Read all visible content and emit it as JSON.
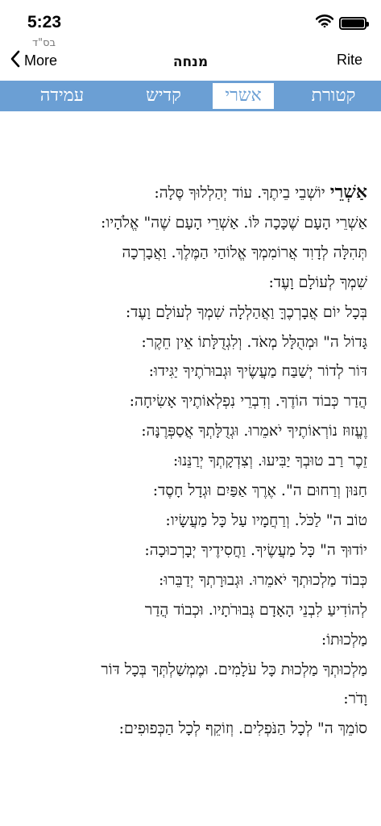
{
  "status_bar": {
    "time": "5:23",
    "icons": [
      "wifi-icon",
      "battery-icon"
    ]
  },
  "header": {
    "hebrew_date": "בס\"ד",
    "back_label": "More",
    "title": "מנחה",
    "rite_label": "Rite"
  },
  "tabs": [
    {
      "label": "קטורת",
      "active": false
    },
    {
      "label": "אשרי",
      "active": true
    },
    {
      "label": "קדיש",
      "active": false
    },
    {
      "label": "עמידה",
      "active": false
    }
  ],
  "colors": {
    "tab_bar": "#6b9fd4",
    "active_tab_background": "#ffffff",
    "tab_text": "#ffffff"
  },
  "prayer": {
    "first_word": "אַשְׁרֵי",
    "first_line_rest": " יוֹשְׁבֵי בֵיתֶךָ. עוֹד יְהַלְלוּךָ סֶּלָה:",
    "lines": [
      "אַשְׁרֵי הָעָם שֶׁכָּכָה לּוֹ. אַשְׁרֵי הָעָם שֶׁה\" אֱלֹהָיו:",
      "תְּהִלָּה לְדָוִד אֲרוֹמִמְךָ אֱלוֹהַי הַמֶּלֶךְ. וַאֲבָרְכָה",
      "שִׁמְךָ לְעוֹלָם וָעֶד:",
      "בְּכָל יוֹם אֲבָרְכֶךָּ וַאֲהַלְלָה שִׁמְךָ לְעוֹלָם וָעֶד:",
      "גָּדוֹל ה\" וּמְהֻלָּל מְאֹד. וְלִגְדֻלָּתוֹ אֵין חֵקֶר:",
      "דּוֹר לְדוֹר יְשַׁבַּח מַעֲשֶׂיךָ וּגְבוּרֹתֶיךָ יַגִּידוּ:",
      "הֲדַר כְּבוֹד הוֹדֶךָ. וְדִבְרֵי נִפְלְאוֹתֶיךָ אָשִׂיחָה:",
      "וֶעֱזוּז נוֹרְאוֹתֶיךָ יֹאמֵרוּ. וּגְדֻלָּתְךָ אֲסַפְּרֶנָּה:",
      "זֵכֶר רַב טוּבְךָ יַבִּיעוּ. וְצִדְקָתְךָ יְרַנֵּנוּ:",
      "חַנּוּן וְרַחוּם ה\". אֶרֶךְ אַפַּיִם וּגְדָל חָסֶד:",
      "טוֹב ה\" לַכֹּל. וְרַחֲמָיו עַל כָּל מַעֲשָׂיו:",
      "יוֹדוּךָ ה\" כָּל מַעֲשֶׂיךָ. וַחֲסִידֶיךָ יְבָרְכוּכָה:",
      "כְּבוֹד מַלְכוּתְךָ יֹאמֵרוּ. וּגְבוּרָתְךָ יְדַבֵּרוּ:",
      "לְהוֹדִיעַ לִבְנֵי הָאָדָם גְּבוּרֹתָיו. וּכְבוֹד הֲדַר",
      "מַלְכוּתוֹ:",
      "מַלְכוּתְךָ מַלְכוּת כָּל עֹלָמִים. וּמֶמְשַׁלְתְּךָ בְּכָל דּוֹר",
      "וָדֹר:",
      "סוֹמֵךְ ה\" לְכָל הַנֹּפְלִים. וְזוֹקֵף לְכָל הַכְּפוּפִים:"
    ]
  }
}
